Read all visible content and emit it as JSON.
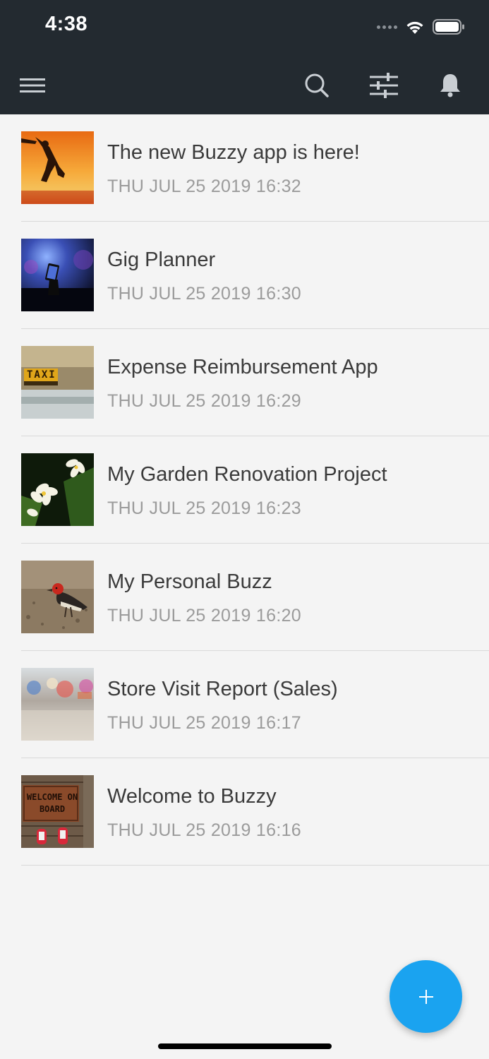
{
  "status_bar": {
    "time": "4:38",
    "signal_icon": "cellular-dots-icon",
    "wifi_icon": "wifi-icon",
    "battery_icon": "battery-icon"
  },
  "toolbar": {
    "menu_icon": "hamburger-menu-icon",
    "search_icon": "search-icon",
    "filter_icon": "sliders-filter-icon",
    "notifications_icon": "bell-icon",
    "background_color": "#232a30"
  },
  "items": [
    {
      "title": "The new Buzzy app is here!",
      "date": "THU JUL 25 2019 16:32",
      "thumbnail": "sunset-jump-photo"
    },
    {
      "title": "Gig Planner",
      "date": "THU JUL 25 2019 16:30",
      "thumbnail": "concert-phone-photo"
    },
    {
      "title": "Expense Reimbursement App",
      "date": "THU JUL 25 2019 16:29",
      "thumbnail": "taxi-sign-photo"
    },
    {
      "title": "My Garden Renovation Project",
      "date": "THU JUL 25 2019 16:23",
      "thumbnail": "plumeria-flowers-photo"
    },
    {
      "title": "My Personal Buzz",
      "date": "THU JUL 25 2019 16:20",
      "thumbnail": "woodpecker-bird-photo"
    },
    {
      "title": "Store Visit Report (Sales)",
      "date": "THU JUL 25 2019 16:17",
      "thumbnail": "blurred-store-photo"
    },
    {
      "title": "Welcome to Buzzy",
      "date": "THU JUL 25 2019 16:16",
      "thumbnail": "welcome-doormat-photo",
      "doormat_text": "WELCOME ON BOARD"
    }
  ],
  "fab": {
    "icon": "plus-icon",
    "color": "#1aa3f0"
  }
}
